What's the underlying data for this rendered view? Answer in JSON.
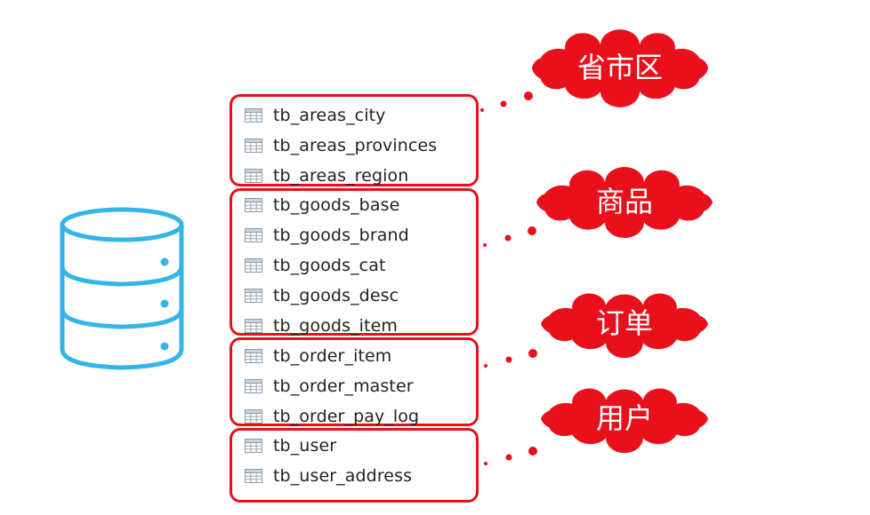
{
  "colors": {
    "accent": "#e8101a",
    "database": "#33b5e8",
    "text": "#222222"
  },
  "groups": [
    {
      "id": "areas",
      "label": "省市区",
      "tables": [
        "tb_areas_city",
        "tb_areas_provinces",
        "tb_areas_region"
      ]
    },
    {
      "id": "goods",
      "label": "商品",
      "tables": [
        "tb_goods_base",
        "tb_goods_brand",
        "tb_goods_cat",
        "tb_goods_desc",
        "tb_goods_item"
      ]
    },
    {
      "id": "order",
      "label": "订单",
      "tables": [
        "tb_order_item",
        "tb_order_master",
        "tb_order_pay_log"
      ]
    },
    {
      "id": "user",
      "label": "用户",
      "tables": [
        "tb_user",
        "tb_user_address"
      ]
    }
  ],
  "icons": {
    "database": "database-icon",
    "table": "table-icon"
  }
}
